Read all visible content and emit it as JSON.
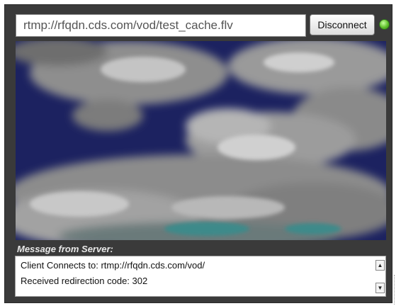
{
  "player": {
    "stream_url": "rtmp://rfqdn.cds.com/vod/test_cache.flv",
    "disconnect_label": "Disconnect",
    "status_color": "#5fbf2a"
  },
  "messages": {
    "label": "Message from Server:",
    "lines": [
      "Client Connects to: rtmp://rfqdn.cds.com/vod/",
      "Received redirection code: 302"
    ]
  },
  "icons": {
    "scroll_up": "▲",
    "scroll_down": "▼"
  }
}
